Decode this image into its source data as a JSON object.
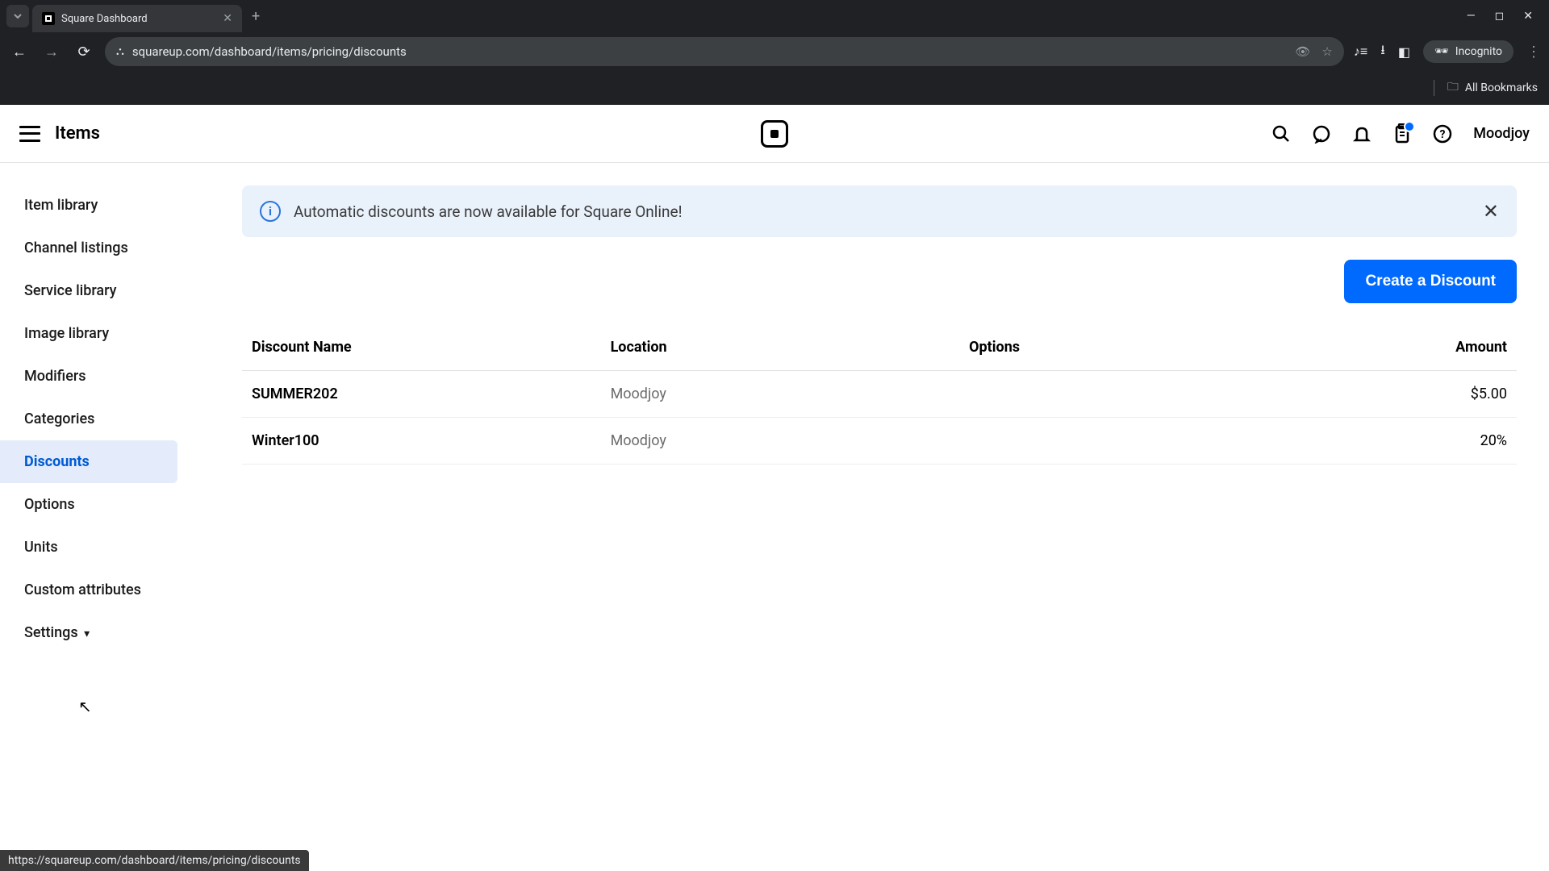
{
  "browser": {
    "tab_title": "Square Dashboard",
    "url": "squareup.com/dashboard/items/pricing/discounts",
    "incognito_label": "Incognito",
    "all_bookmarks": "All Bookmarks",
    "status_url": "https://squareup.com/dashboard/items/pricing/discounts"
  },
  "header": {
    "title": "Items",
    "user": "Moodjoy"
  },
  "sidebar": {
    "items": [
      {
        "label": "Item library"
      },
      {
        "label": "Channel listings"
      },
      {
        "label": "Service library"
      },
      {
        "label": "Image library"
      },
      {
        "label": "Modifiers"
      },
      {
        "label": "Categories"
      },
      {
        "label": "Discounts"
      },
      {
        "label": "Options"
      },
      {
        "label": "Units"
      },
      {
        "label": "Custom attributes"
      },
      {
        "label": "Settings"
      }
    ]
  },
  "banner": {
    "text": "Automatic discounts are now available for Square Online!"
  },
  "actions": {
    "create_discount": "Create a Discount"
  },
  "table": {
    "headers": {
      "name": "Discount Name",
      "location": "Location",
      "options": "Options",
      "amount": "Amount"
    },
    "rows": [
      {
        "name": "SUMMER202",
        "location": "Moodjoy",
        "options": "",
        "amount": "$5.00"
      },
      {
        "name": "Winter100",
        "location": "Moodjoy",
        "options": "",
        "amount": "20%"
      }
    ]
  }
}
